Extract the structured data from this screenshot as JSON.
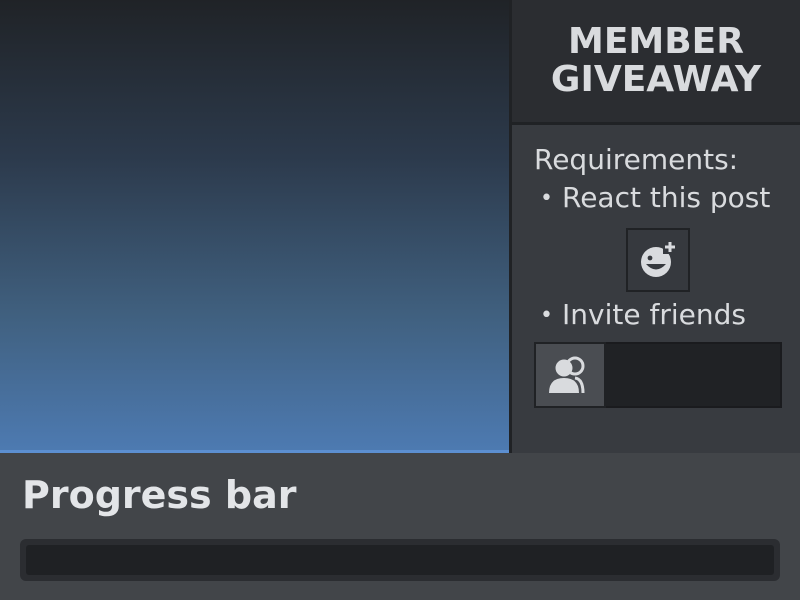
{
  "sidebar": {
    "title_line1": "MEMBER",
    "title_line2": "GIVEAWAY",
    "requirements_label": "Requirements:",
    "requirements": [
      {
        "bullet": "•",
        "label": "React this post",
        "icon": "add-reaction-icon"
      },
      {
        "bullet": "•",
        "label": "Invite friends",
        "icon": "users-icon"
      }
    ],
    "invite_field_value": ""
  },
  "progress": {
    "title": "Progress bar",
    "value": 0
  },
  "colors": {
    "accent": "#5c8fd1",
    "sidebar_bg": "#383b40",
    "header_bg": "#2b2d31",
    "bottom_bg": "#424549",
    "text": "#d9dbde"
  }
}
